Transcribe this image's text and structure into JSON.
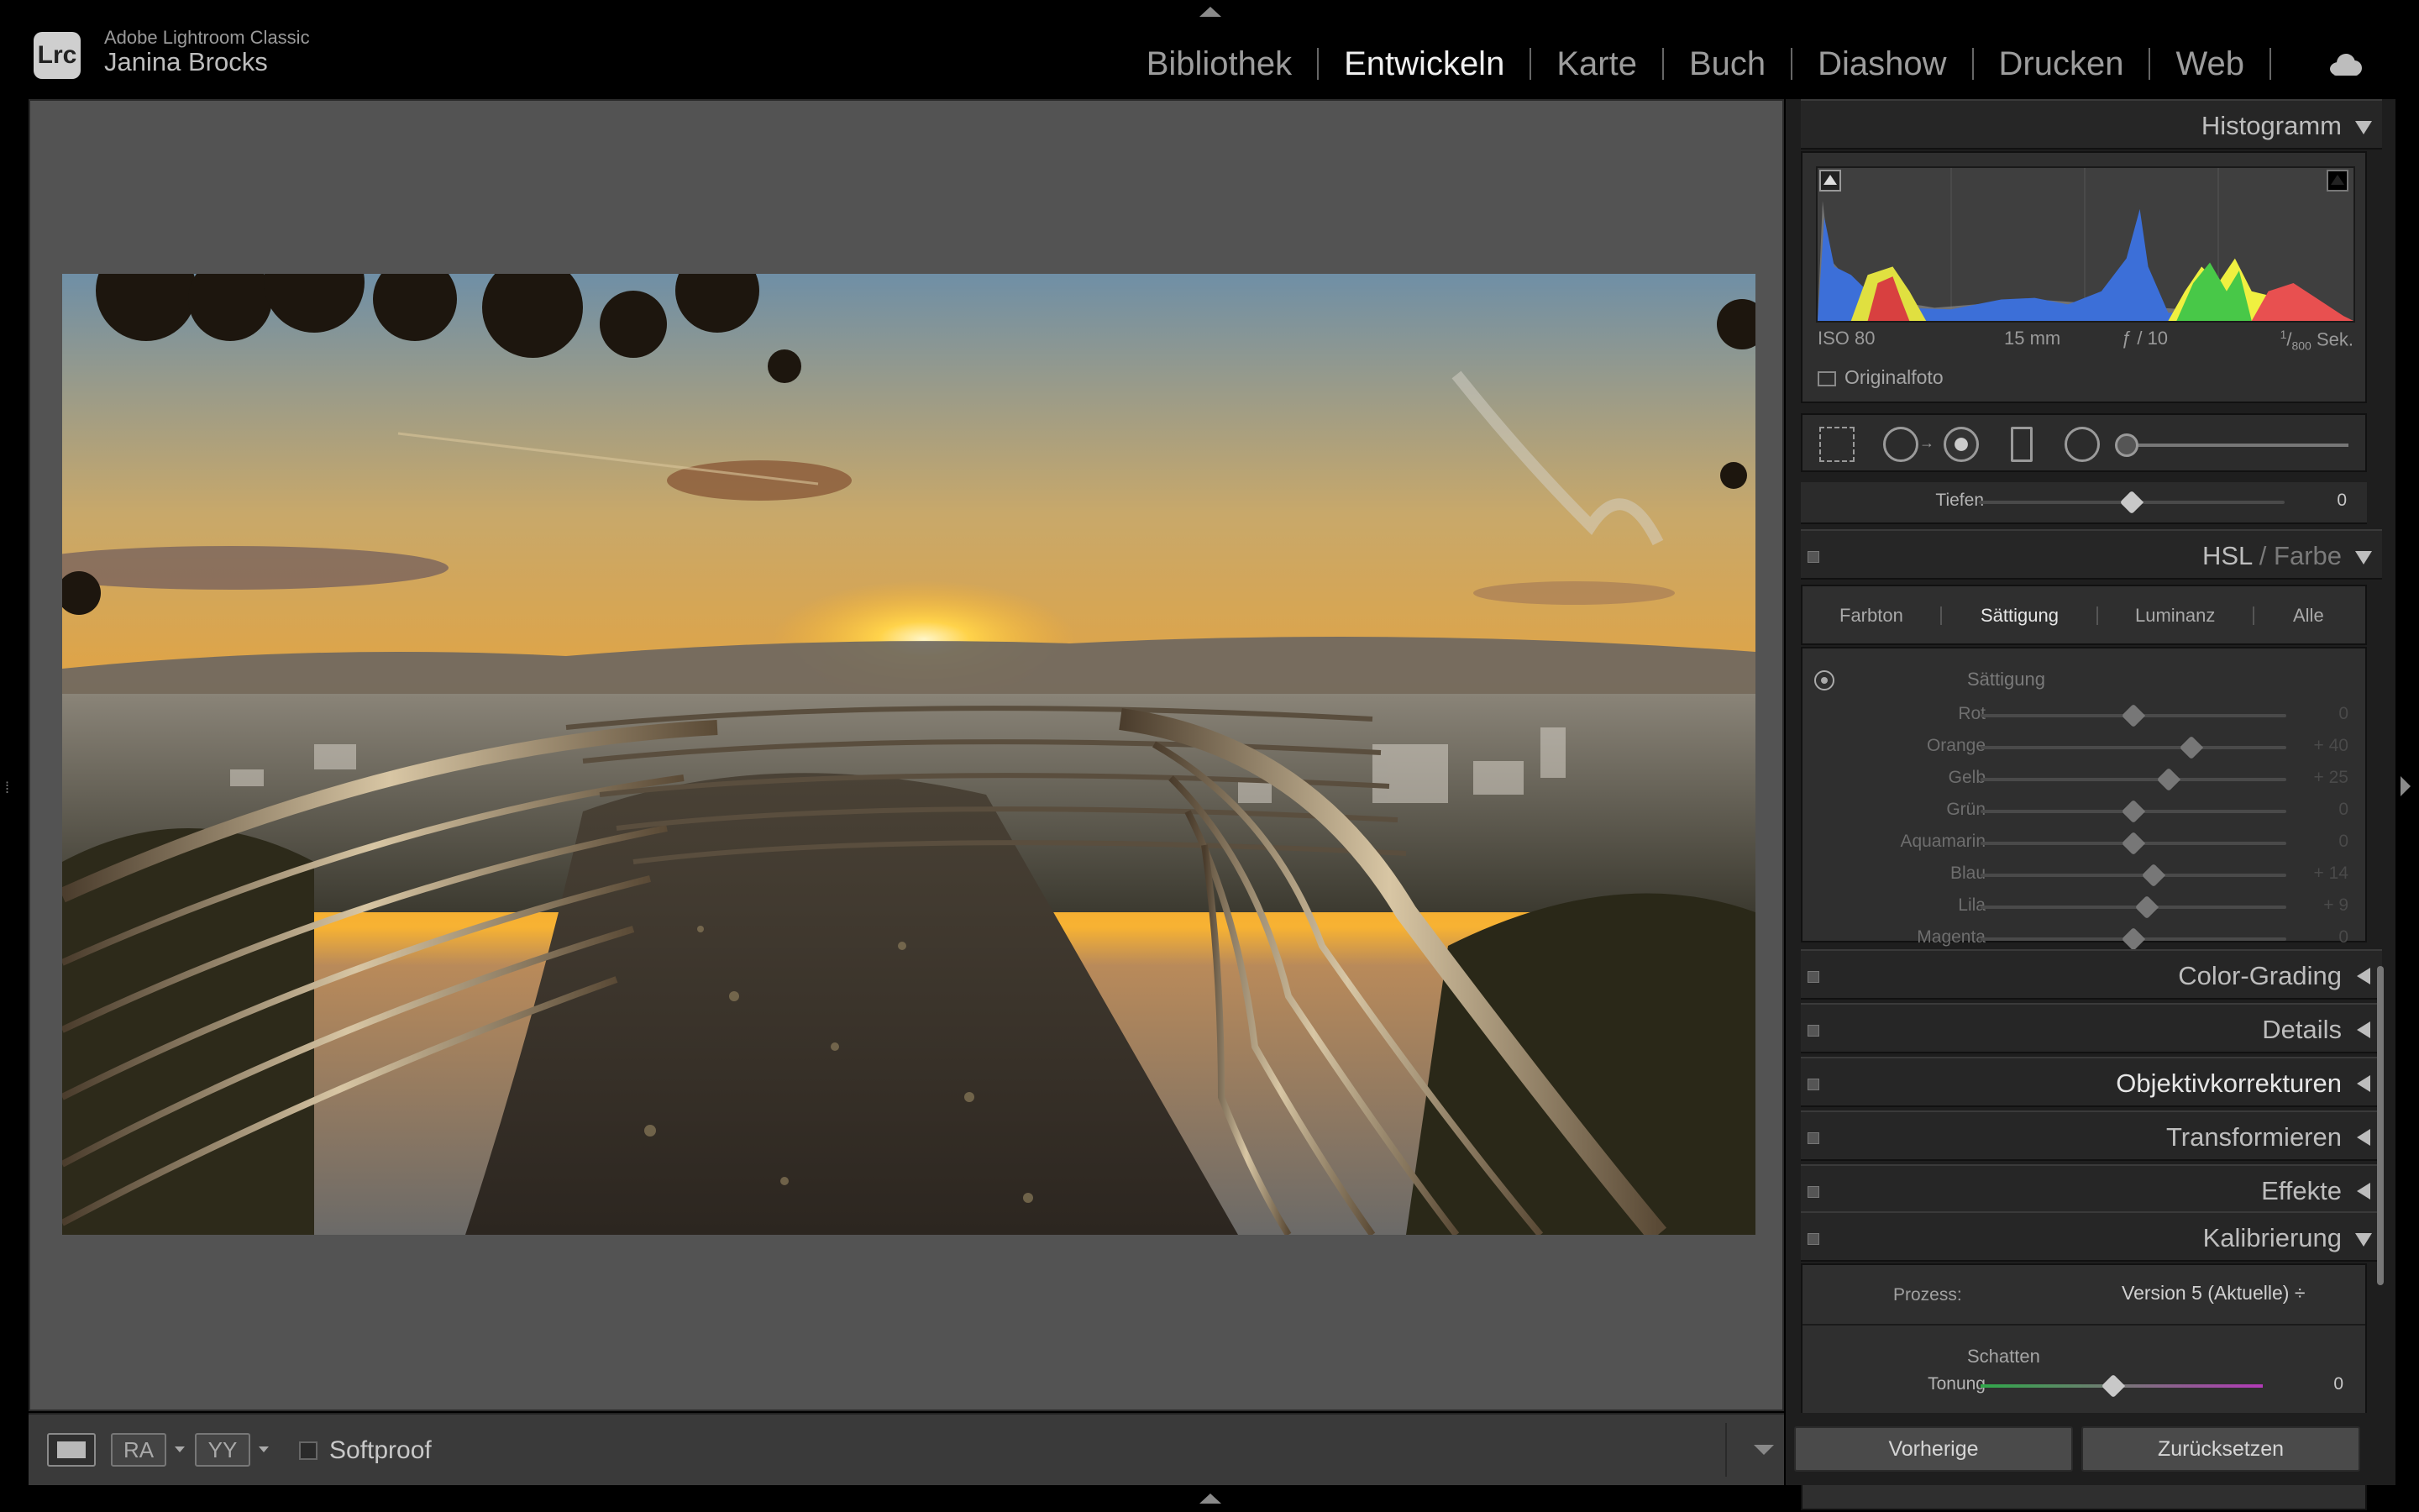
{
  "app": {
    "name": "Adobe Lightroom Classic",
    "logo": "Lrc",
    "user": "Janina Brocks"
  },
  "modules": [
    {
      "label": "Bibliothek",
      "active": false
    },
    {
      "label": "Entwickeln",
      "active": true
    },
    {
      "label": "Karte",
      "active": false
    },
    {
      "label": "Buch",
      "active": false
    },
    {
      "label": "Diashow",
      "active": false
    },
    {
      "label": "Drucken",
      "active": false
    },
    {
      "label": "Web",
      "active": false
    }
  ],
  "toolbar": {
    "view_ra": "RA",
    "view_yy": "YY",
    "softproof": "Softproof"
  },
  "histogram": {
    "title": "Histogramm",
    "iso": "ISO 80",
    "focal": "15 mm",
    "aperture": "ƒ / 10",
    "shutter_num": "1",
    "shutter_den": "800",
    "shutter_unit": "Sek.",
    "original": "Originalfoto"
  },
  "tonal": {
    "label": "Tiefen",
    "value": "0",
    "level": 0.5
  },
  "hsl": {
    "title_a": "HSL",
    "sep": "/",
    "title_b": "Farbe",
    "tabs": [
      "Farbton",
      "Sättigung",
      "Luminanz",
      "Alle"
    ],
    "subtitle": "Sättigung",
    "rows": [
      {
        "label": "Rot",
        "value": "0",
        "level": 0.5
      },
      {
        "label": "Orange",
        "value": "+ 40",
        "level": 0.69
      },
      {
        "label": "Gelb",
        "value": "+ 25",
        "level": 0.615
      },
      {
        "label": "Grün",
        "value": "0",
        "level": 0.5
      },
      {
        "label": "Aquamarin",
        "value": "0",
        "level": 0.5
      },
      {
        "label": "Blau",
        "value": "+ 14",
        "level": 0.565
      },
      {
        "label": "Lila",
        "value": "+ 9",
        "level": 0.545
      },
      {
        "label": "Magenta",
        "value": "0",
        "level": 0.5
      }
    ]
  },
  "panels": [
    {
      "title": "Color-Grading"
    },
    {
      "title": "Details"
    },
    {
      "title": "Objektivkorrekturen"
    },
    {
      "title": "Transformieren"
    },
    {
      "title": "Effekte"
    }
  ],
  "calibration": {
    "title": "Kalibrierung",
    "prozess_label": "Prozess:",
    "prozess_value": "Version 5 (Aktuelle) ÷",
    "schatten": "Schatten",
    "tonung_label": "Tonung",
    "tonung_value": "0",
    "tonung_level": 0.47
  },
  "buttons": {
    "previous": "Vorherige",
    "reset": "Zurücksetzen"
  },
  "colors": {
    "accent_active": "#f0f0f0",
    "panel_bg": "#2f2f2f",
    "canvas_bg": "#535353"
  },
  "icons": [
    "cloud-icon",
    "crop-icon",
    "spot-removal-icon",
    "red-eye-icon",
    "graduated-filter-icon",
    "radial-filter-icon",
    "target-adjust-icon"
  ]
}
